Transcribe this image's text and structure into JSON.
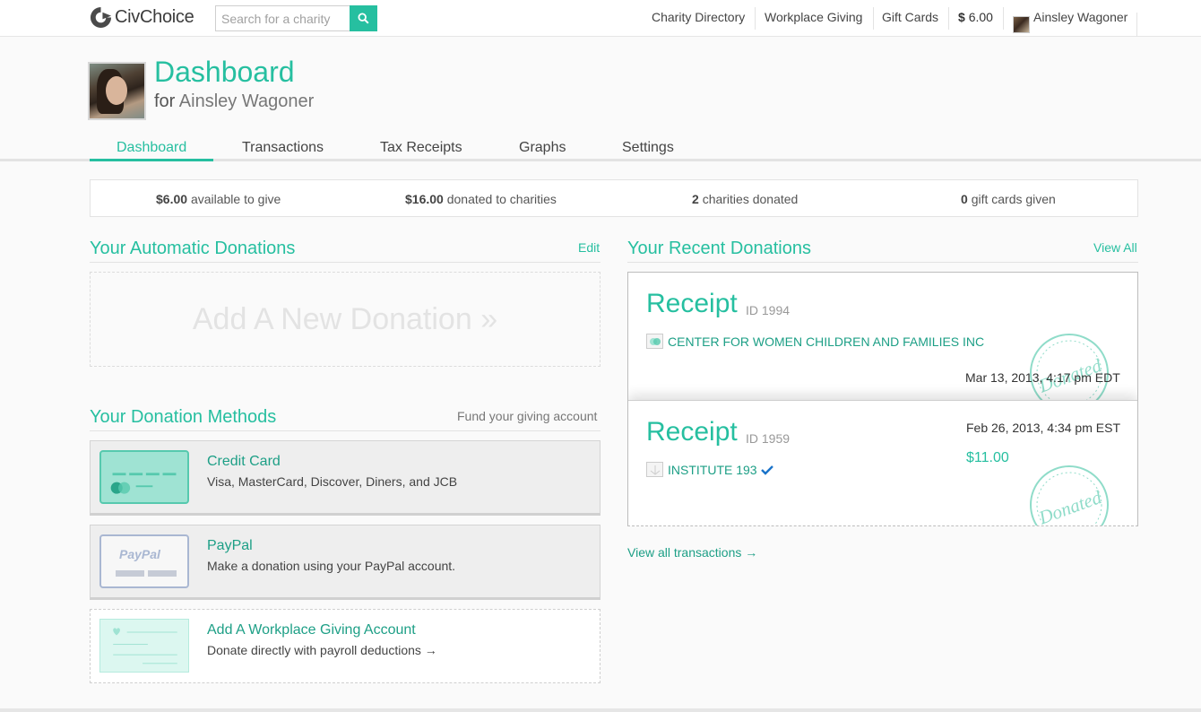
{
  "brand": {
    "name": "CivChoice",
    "accent": "#26bfa0"
  },
  "search": {
    "placeholder": "Search for a charity",
    "value": ""
  },
  "topnav": {
    "links": [
      "Charity Directory",
      "Workplace Giving",
      "Gift Cards"
    ],
    "balance_symbol": "$",
    "balance_value": "6.00",
    "user_name": "Ainsley Wagoner"
  },
  "header": {
    "title": "Dashboard",
    "subtitle_prefix": "for",
    "subtitle_name": "Ainsley Wagoner"
  },
  "tabs": [
    {
      "label": "Dashboard",
      "active": true
    },
    {
      "label": "Transactions",
      "active": false
    },
    {
      "label": "Tax Receipts",
      "active": false
    },
    {
      "label": "Graphs",
      "active": false
    },
    {
      "label": "Settings",
      "active": false
    }
  ],
  "stats": [
    {
      "value": "$6.00",
      "label": "available to give"
    },
    {
      "value": "$16.00",
      "label": "donated to charities"
    },
    {
      "value": "2",
      "label": "charities donated"
    },
    {
      "value": "0",
      "label": "gift cards given"
    }
  ],
  "automatic": {
    "title": "Your Automatic Donations",
    "edit_label": "Edit",
    "add_label": "Add A New Donation »"
  },
  "methods": {
    "title": "Your Donation Methods",
    "fund_label": "Fund your giving account",
    "items": [
      {
        "title": "Credit Card",
        "desc": "Visa, MasterCard, Discover, Diners, and JCB"
      },
      {
        "title": "PayPal",
        "desc": "Make a donation using your PayPal account.",
        "card_text": "PayPal"
      },
      {
        "title": "Add A Workplace Giving Account",
        "desc": "Donate directly with payroll deductions →"
      }
    ]
  },
  "recent": {
    "title": "Your Recent Donations",
    "view_all_label": "View All",
    "stamp_text": "Donated",
    "receipts": [
      {
        "title": "Receipt",
        "id_label": "ID 1994",
        "charity": "CENTER FOR WOMEN CHILDREN AND FAMILIES INC",
        "date": "Mar 13, 2013, 4:17 pm EDT"
      },
      {
        "title": "Receipt",
        "id_label": "ID 1959",
        "charity": "INSTITUTE 193",
        "date": "Feb 26, 2013, 4:34 pm EST",
        "amount": "$11.00"
      }
    ],
    "view_transactions_label": "View all transactions →"
  }
}
